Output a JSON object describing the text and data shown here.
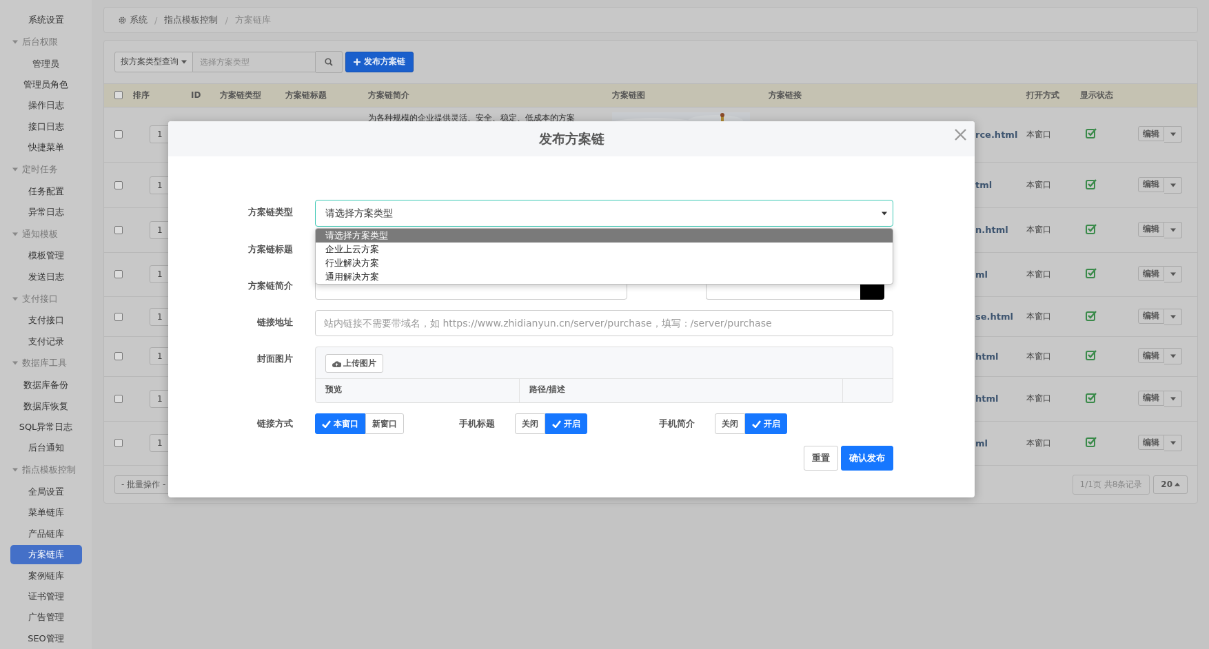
{
  "sidebar": {
    "items": [
      {
        "label": "系统设置",
        "selected": false
      },
      {
        "label": "后台权限",
        "expanded": true,
        "children": [
          {
            "label": "管理员",
            "selected": false
          },
          {
            "label": "管理员角色",
            "selected": false
          },
          {
            "label": "操作日志",
            "selected": false
          },
          {
            "label": "接口日志",
            "selected": false
          },
          {
            "label": "快捷菜单",
            "selected": false
          }
        ]
      },
      {
        "label": "定时任务",
        "expanded": true,
        "children": [
          {
            "label": "任务配置",
            "selected": false
          },
          {
            "label": "异常日志",
            "selected": false
          }
        ]
      },
      {
        "label": "通知模板",
        "expanded": true,
        "children": [
          {
            "label": "模板管理",
            "selected": false
          },
          {
            "label": "发送日志",
            "selected": false
          }
        ]
      },
      {
        "label": "支付接口",
        "expanded": true,
        "children": [
          {
            "label": "支付接口",
            "selected": false
          },
          {
            "label": "支付记录",
            "selected": false
          }
        ]
      },
      {
        "label": "数据库工具",
        "expanded": true,
        "children": [
          {
            "label": "数据库备份",
            "selected": false
          },
          {
            "label": "数据库恢复",
            "selected": false
          },
          {
            "label": "SQL异常日志",
            "selected": false
          }
        ]
      },
      {
        "label": "后台通知",
        "selected": false
      },
      {
        "label": "指点模板控制",
        "expanded": true,
        "children": [
          {
            "label": "全局设置",
            "selected": false
          },
          {
            "label": "菜单链库",
            "selected": false
          },
          {
            "label": "产品链库",
            "selected": false
          },
          {
            "label": "方案链库",
            "selected": true
          },
          {
            "label": "案例链库",
            "selected": false
          },
          {
            "label": "证书管理",
            "selected": false
          },
          {
            "label": "广告管理",
            "selected": false
          },
          {
            "label": "SEO管理",
            "selected": false
          }
        ]
      }
    ]
  },
  "breadcrumb": [
    {
      "kind": "link",
      "label": "系统"
    },
    {
      "kind": "separator",
      "label": "/"
    },
    {
      "kind": "link",
      "label": "指点模板控制"
    },
    {
      "kind": "separator",
      "label": "/"
    },
    {
      "kind": "current",
      "label": "方案链库"
    }
  ],
  "toolbar": {
    "filter_button": "按方案类型查询",
    "search_placeholder": "选择方案类型",
    "publish_button": "发布方案链"
  },
  "table": {
    "select_all_checked": false,
    "columns": [
      "排序",
      "ID",
      "方案链类型",
      "方案链标题",
      "方案链简介",
      "方案链图",
      "方案链接",
      "打开方式",
      "显示状态"
    ],
    "rows": [
      {
        "checked": false,
        "sort": "1",
        "intro": "为各种规模的企业提供灵活、安全、稳定、低成本的方案",
        "link": "rce.html",
        "open_mode": "本窗口",
        "visible": true,
        "action": "编辑"
      },
      {
        "checked": false,
        "sort": "1",
        "link": "tml",
        "open_mode": "本窗口",
        "visible": true,
        "action": "编辑"
      },
      {
        "checked": false,
        "sort": "1",
        "link": "n.html",
        "open_mode": "本窗口",
        "visible": true,
        "action": "编辑"
      },
      {
        "checked": false,
        "sort": "1",
        "link": "ml",
        "open_mode": "本窗口",
        "visible": true,
        "action": "编辑"
      },
      {
        "checked": false,
        "sort": "1",
        "link": "se.html",
        "open_mode": "本窗口",
        "visible": true,
        "action": "编辑"
      },
      {
        "checked": false,
        "sort": "1",
        "link": "html",
        "open_mode": "本窗口",
        "visible": true,
        "action": "编辑"
      },
      {
        "checked": false,
        "sort": "1",
        "link": "html",
        "open_mode": "本窗口",
        "visible": true,
        "action": "编辑"
      },
      {
        "checked": false,
        "sort": "1",
        "link": "ml",
        "open_mode": "本窗口",
        "visible": true,
        "action": "编辑"
      }
    ],
    "batch_button": "- 批量操作 -",
    "page_info": "1/1页 共8条记录",
    "page_size": "20"
  },
  "modal": {
    "title": "发布方案链",
    "fields": [
      {
        "kind": "select",
        "label": "方案链类型",
        "value": "请选择方案类型",
        "expanded": true,
        "options": [
          {
            "label": "请选择方案类型",
            "selected": true
          },
          {
            "label": "企业上云方案",
            "selected": false
          },
          {
            "label": "行业解决方案",
            "selected": false
          },
          {
            "label": "通用解决方案",
            "selected": false
          }
        ]
      },
      {
        "kind": "text",
        "label": "方案链标题"
      },
      {
        "kind": "text_color",
        "label": "方案链简介"
      },
      {
        "kind": "text",
        "label": "链接地址",
        "placeholder": "站内链接不需要带域名，如 https://www.zhidianyun.cn/server/purchase，填写：/server/purchase"
      },
      {
        "kind": "upload",
        "label": "封面图片",
        "button": "上传图片",
        "columns": [
          "预览",
          "路径/描述"
        ]
      }
    ],
    "toggles": [
      {
        "label": "链接方式",
        "options": [
          {
            "label": "本窗口",
            "selected": true
          },
          {
            "label": "新窗口",
            "selected": false
          }
        ]
      },
      {
        "label": "手机标题",
        "options": [
          {
            "label": "关闭",
            "selected": false
          },
          {
            "label": "开启",
            "selected": true
          }
        ]
      },
      {
        "label": "手机简介",
        "options": [
          {
            "label": "关闭",
            "selected": false
          },
          {
            "label": "开启",
            "selected": true
          }
        ]
      }
    ],
    "reset_button": "重置",
    "submit_button": "确认发布"
  }
}
